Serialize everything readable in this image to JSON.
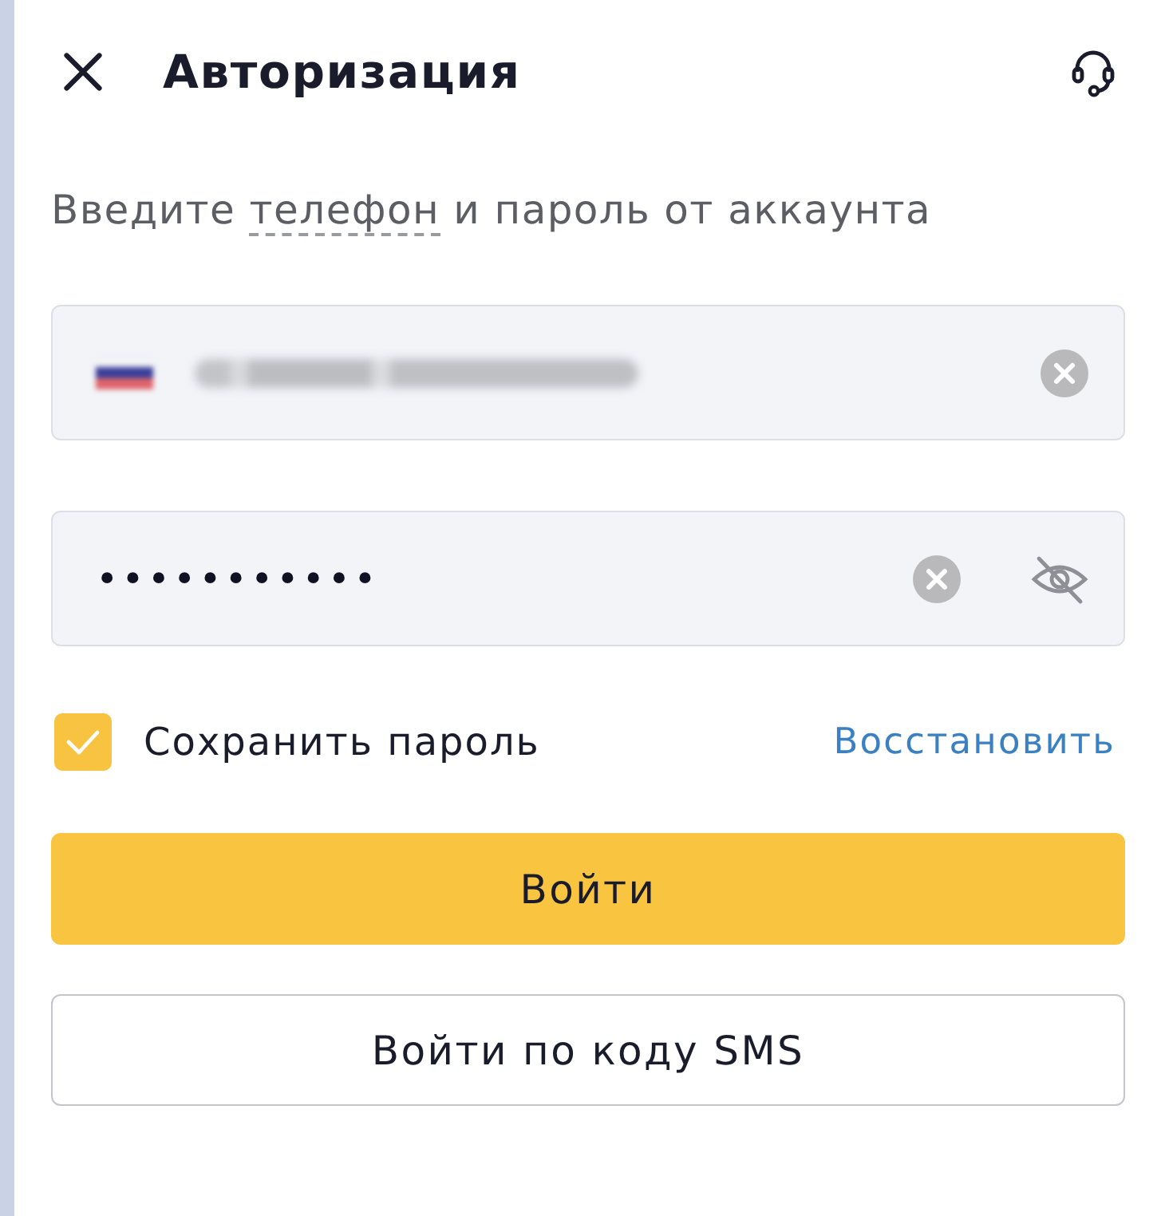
{
  "header": {
    "title": "Авторизация"
  },
  "instruction": {
    "parts": [
      {
        "text": "Введите ",
        "dashed": false
      },
      {
        "text": "телефон",
        "dashed": true
      },
      {
        "text": " и пароль от аккаунта",
        "dashed": false
      }
    ]
  },
  "fields": [
    {
      "kind": "phone",
      "blurred": true,
      "clearable": true
    },
    {
      "kind": "password",
      "value": "•••••••••••",
      "clearable": true,
      "masked": true
    }
  ],
  "remember": {
    "label": "Сохранить пароль",
    "checked": true
  },
  "restore_link": "Восстановить",
  "buttons": [
    {
      "label": "Войти",
      "kind": "primary"
    },
    {
      "label": "Войти по коду SMS",
      "kind": "secondary"
    }
  ]
}
